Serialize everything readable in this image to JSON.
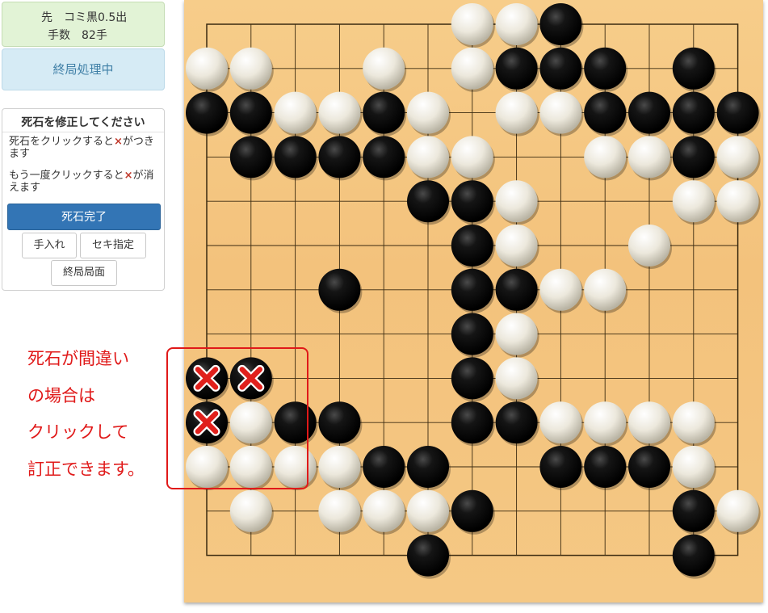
{
  "game_info": {
    "line1": "先　コミ黒0.5出",
    "line2": "手数　82手"
  },
  "status": {
    "label": "終局処理中"
  },
  "dead_stone_panel": {
    "title": "死石を修正してください",
    "instruction_1_pre": "死石をクリックすると",
    "instruction_1_mark": "×",
    "instruction_1_post": "がつきます",
    "instruction_2_pre": "もう一度クリックすると",
    "instruction_2_mark": "×",
    "instruction_2_post": "が消えます",
    "done_button": "死石完了",
    "tesuire_button": "手入れ",
    "seki_button": "セキ指定",
    "final_position_button": "終局局面"
  },
  "annotation": {
    "line1": "死石が間違い",
    "line2": "の場合は",
    "line3": "クリックして",
    "line4": "訂正できます。"
  },
  "colors": {
    "callout": "#e01919",
    "board": "#f5c884",
    "primary_button": "#3375b5",
    "dead_mark": "#e0201c"
  },
  "board": {
    "size": 13,
    "stones": [
      {
        "col": 6,
        "row": 0,
        "color": "white"
      },
      {
        "col": 7,
        "row": 0,
        "color": "white"
      },
      {
        "col": 8,
        "row": 0,
        "color": "black"
      },
      {
        "col": 0,
        "row": 1,
        "color": "white"
      },
      {
        "col": 1,
        "row": 1,
        "color": "white"
      },
      {
        "col": 4,
        "row": 1,
        "color": "white"
      },
      {
        "col": 6,
        "row": 1,
        "color": "white"
      },
      {
        "col": 7,
        "row": 1,
        "color": "black"
      },
      {
        "col": 8,
        "row": 1,
        "color": "black"
      },
      {
        "col": 9,
        "row": 1,
        "color": "black"
      },
      {
        "col": 11,
        "row": 1,
        "color": "black"
      },
      {
        "col": 0,
        "row": 2,
        "color": "black"
      },
      {
        "col": 1,
        "row": 2,
        "color": "black"
      },
      {
        "col": 2,
        "row": 2,
        "color": "white"
      },
      {
        "col": 3,
        "row": 2,
        "color": "white"
      },
      {
        "col": 4,
        "row": 2,
        "color": "black"
      },
      {
        "col": 5,
        "row": 2,
        "color": "white"
      },
      {
        "col": 7,
        "row": 2,
        "color": "white"
      },
      {
        "col": 8,
        "row": 2,
        "color": "white"
      },
      {
        "col": 9,
        "row": 2,
        "color": "black"
      },
      {
        "col": 10,
        "row": 2,
        "color": "black"
      },
      {
        "col": 11,
        "row": 2,
        "color": "black"
      },
      {
        "col": 12,
        "row": 2,
        "color": "black"
      },
      {
        "col": 1,
        "row": 3,
        "color": "black"
      },
      {
        "col": 2,
        "row": 3,
        "color": "black"
      },
      {
        "col": 3,
        "row": 3,
        "color": "black"
      },
      {
        "col": 4,
        "row": 3,
        "color": "black"
      },
      {
        "col": 5,
        "row": 3,
        "color": "white"
      },
      {
        "col": 6,
        "row": 3,
        "color": "white"
      },
      {
        "col": 9,
        "row": 3,
        "color": "white"
      },
      {
        "col": 10,
        "row": 3,
        "color": "white"
      },
      {
        "col": 11,
        "row": 3,
        "color": "black"
      },
      {
        "col": 12,
        "row": 3,
        "color": "white"
      },
      {
        "col": 5,
        "row": 4,
        "color": "black"
      },
      {
        "col": 6,
        "row": 4,
        "color": "black"
      },
      {
        "col": 7,
        "row": 4,
        "color": "white"
      },
      {
        "col": 11,
        "row": 4,
        "color": "white"
      },
      {
        "col": 12,
        "row": 4,
        "color": "white"
      },
      {
        "col": 6,
        "row": 5,
        "color": "black"
      },
      {
        "col": 7,
        "row": 5,
        "color": "white"
      },
      {
        "col": 10,
        "row": 5,
        "color": "white"
      },
      {
        "col": 3,
        "row": 6,
        "color": "black"
      },
      {
        "col": 6,
        "row": 6,
        "color": "black"
      },
      {
        "col": 7,
        "row": 6,
        "color": "black"
      },
      {
        "col": 8,
        "row": 6,
        "color": "white"
      },
      {
        "col": 9,
        "row": 6,
        "color": "white"
      },
      {
        "col": 6,
        "row": 7,
        "color": "black"
      },
      {
        "col": 7,
        "row": 7,
        "color": "white"
      },
      {
        "col": 0,
        "row": 8,
        "color": "black",
        "dead": true
      },
      {
        "col": 1,
        "row": 8,
        "color": "black",
        "dead": true
      },
      {
        "col": 6,
        "row": 8,
        "color": "black"
      },
      {
        "col": 7,
        "row": 8,
        "color": "white"
      },
      {
        "col": 0,
        "row": 9,
        "color": "black",
        "dead": true
      },
      {
        "col": 1,
        "row": 9,
        "color": "white"
      },
      {
        "col": 2,
        "row": 9,
        "color": "black"
      },
      {
        "col": 3,
        "row": 9,
        "color": "black"
      },
      {
        "col": 6,
        "row": 9,
        "color": "black"
      },
      {
        "col": 7,
        "row": 9,
        "color": "black"
      },
      {
        "col": 8,
        "row": 9,
        "color": "white"
      },
      {
        "col": 9,
        "row": 9,
        "color": "white"
      },
      {
        "col": 10,
        "row": 9,
        "color": "white"
      },
      {
        "col": 11,
        "row": 9,
        "color": "white"
      },
      {
        "col": 0,
        "row": 10,
        "color": "white"
      },
      {
        "col": 1,
        "row": 10,
        "color": "white"
      },
      {
        "col": 2,
        "row": 10,
        "color": "white"
      },
      {
        "col": 3,
        "row": 10,
        "color": "white"
      },
      {
        "col": 4,
        "row": 10,
        "color": "black"
      },
      {
        "col": 5,
        "row": 10,
        "color": "black"
      },
      {
        "col": 8,
        "row": 10,
        "color": "black"
      },
      {
        "col": 9,
        "row": 10,
        "color": "black"
      },
      {
        "col": 10,
        "row": 10,
        "color": "black"
      },
      {
        "col": 11,
        "row": 10,
        "color": "white"
      },
      {
        "col": 1,
        "row": 11,
        "color": "white"
      },
      {
        "col": 3,
        "row": 11,
        "color": "white"
      },
      {
        "col": 4,
        "row": 11,
        "color": "white"
      },
      {
        "col": 5,
        "row": 11,
        "color": "white"
      },
      {
        "col": 6,
        "row": 11,
        "color": "black"
      },
      {
        "col": 11,
        "row": 11,
        "color": "black"
      },
      {
        "col": 12,
        "row": 11,
        "color": "white"
      },
      {
        "col": 5,
        "row": 12,
        "color": "black"
      },
      {
        "col": 11,
        "row": 12,
        "color": "black"
      }
    ]
  }
}
